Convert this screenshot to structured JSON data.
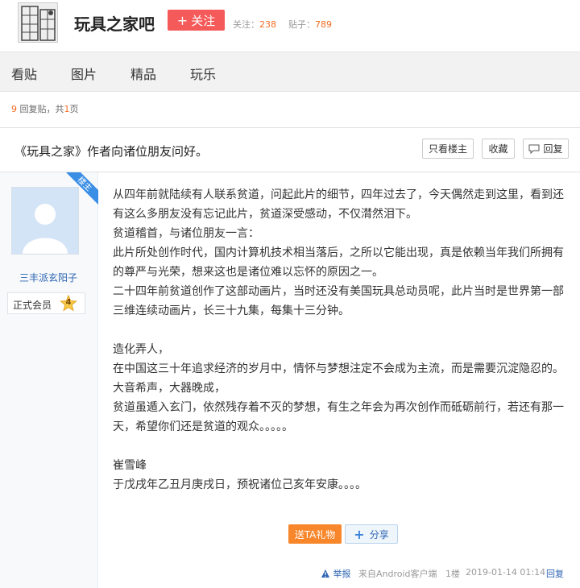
{
  "header": {
    "forum_name": "玩具之家吧",
    "follow_label": "关注",
    "follow_icon": "plus-icon",
    "stats": {
      "followers_label": "关注：",
      "followers_count": "238",
      "posts_label": "贴子：",
      "posts_count": "789"
    }
  },
  "nav": {
    "items": [
      {
        "label": "看贴"
      },
      {
        "label": "图片"
      },
      {
        "label": "精品"
      },
      {
        "label": "玩乐"
      }
    ]
  },
  "pager": {
    "reply_count": "9",
    "replies_text": "回复贴，共",
    "page_count": "1",
    "page_suffix": "页"
  },
  "thread": {
    "title": "《玩具之家》作者向诸位朋友问好。",
    "only_op_label": "只看楼主",
    "favorite_label": "收藏",
    "reply_label": "回复",
    "reply_icon": "speech-bubble-icon"
  },
  "post": {
    "op_badge": "楼主",
    "author": {
      "name": "三丰派玄阳子",
      "rank_label": "正式会员",
      "level": "4"
    },
    "lines": [
      "从四年前就陆续有人联系贫道，问起此片的细节，四年过去了，今天偶然走到这里，看到还",
      "有这么多朋友没有忘记此片，贫道深受感动，不仅潸然泪下。",
      "贫道稽首，与诸位朋友一言：",
      "此片所处创作时代，国内计算机技术相当落后，之所以它能出现，真是依赖当年我们所拥有",
      "的尊严与光荣，想来这也是诸位难以忘怀的原因之一。",
      "二十四年前贫道创作了这部动画片，当时还没有美国玩具总动员呢，此片当时是世界第一部",
      "三维连续动画片，长三十九集，每集十三分钟。",
      "",
      "造化弄人，",
      "在中国这三十年追求经济的岁月中，情怀与梦想注定不会成为主流，而是需要沉淀隐忍的。",
      "大音希声，大器晚成，",
      "贫道虽遁入玄门，依然残存着不灭的梦想，有生之年会为再次创作而砥砺前行，若还有那一",
      "天，希望你们还是贫道的观众。。。。。",
      "",
      "崔雪峰",
      "于戊戌年乙丑月庚戌日，预祝诸位己亥年安康。。。。"
    ],
    "gift_label": "送TA礼物",
    "share_label": "分享",
    "footer": {
      "report_label": "举报",
      "source": "来自Android客户端",
      "floor": "1楼",
      "datetime": "2019-01-14 01:14",
      "reply_label": "回复"
    }
  },
  "colors": {
    "accent_red": "#f55a5a",
    "count_orange": "#f36c21",
    "link_blue": "#2d64b3",
    "gift_orange": "#f8862a"
  }
}
